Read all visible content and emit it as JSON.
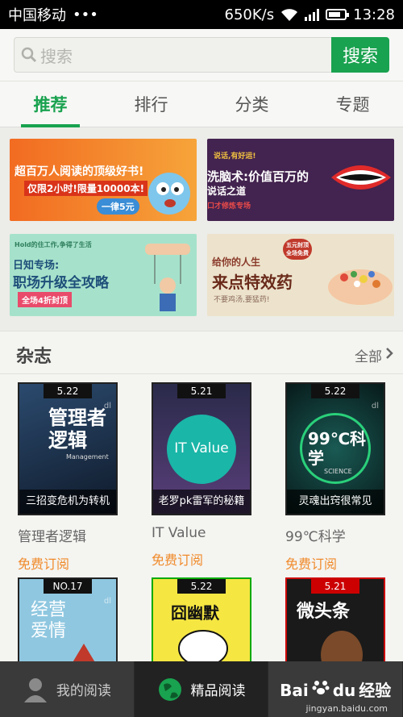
{
  "status": {
    "carrier": "中国移动",
    "dots": "•••",
    "speed": "650K/s",
    "time": "13:28"
  },
  "search": {
    "placeholder": "搜索",
    "button_label": "搜索"
  },
  "tabs": [
    {
      "label": "推荐",
      "active": true
    },
    {
      "label": "排行"
    },
    {
      "label": "分类"
    },
    {
      "label": "专题"
    }
  ],
  "banners": {
    "b1": {
      "line1": "超百万人阅读的顶级好书!",
      "line2": "仅限2小时!限量10000本!",
      "badge": "一律5元"
    },
    "b2": {
      "small": "说话,有好运!",
      "line1": "洗脑术:价值百万的",
      "line2": "说话之道",
      "tag": "口才修炼专场"
    },
    "b3": {
      "small": "Hold的住工作,争得了生活",
      "line1": "日知专场:",
      "line2": "职场升级全攻略",
      "badge": "全场4折封顶"
    },
    "b4": {
      "line1": "给你的人生",
      "line2": "来点特效药",
      "small": "不要鸡汤,要猛药!",
      "stamp": "五元封顶 全场免费"
    }
  },
  "section": {
    "title": "杂志",
    "more": "全部"
  },
  "magazines": [
    {
      "issue": "5.22",
      "cover_title": "管理者逻辑",
      "cover_sub": "Management",
      "caption": "三招变危机为转机",
      "title": "管理者逻辑",
      "action": "免费订阅",
      "bg": "#1e2e45"
    },
    {
      "issue": "5.21",
      "cover_title": "IT Value",
      "caption": "老罗pk雷军的秘籍",
      "title": "IT Value",
      "action": "免费订阅",
      "bg": "#3a2f5e"
    },
    {
      "issue": "5.22",
      "cover_title": "99℃科学",
      "cover_sub": "SCIENCE",
      "caption": "灵魂出窍很常见",
      "title": "99℃科学",
      "action": "免费订阅",
      "bg": "#0f3d3a"
    },
    {
      "issue": "NO.17",
      "cover_title": "经营爱情",
      "bg": "#8fc7e0"
    },
    {
      "issue": "5.22",
      "cover_title": "囧幽默",
      "bg": "#f5e642"
    },
    {
      "issue": "5.21",
      "cover_title": "微头条",
      "bg": "#1a1a1a"
    }
  ],
  "dl_mark": "dl",
  "bottom_nav": [
    {
      "label": "我的阅读"
    },
    {
      "label": "精品阅读",
      "active": true
    },
    {
      "label": "经验"
    }
  ],
  "watermark": {
    "brand": "Bai",
    "brand2": "du",
    "sub": "jingyan.baidu.com"
  },
  "colors": {
    "accent": "#19a24f",
    "orange": "#f08a2a"
  }
}
